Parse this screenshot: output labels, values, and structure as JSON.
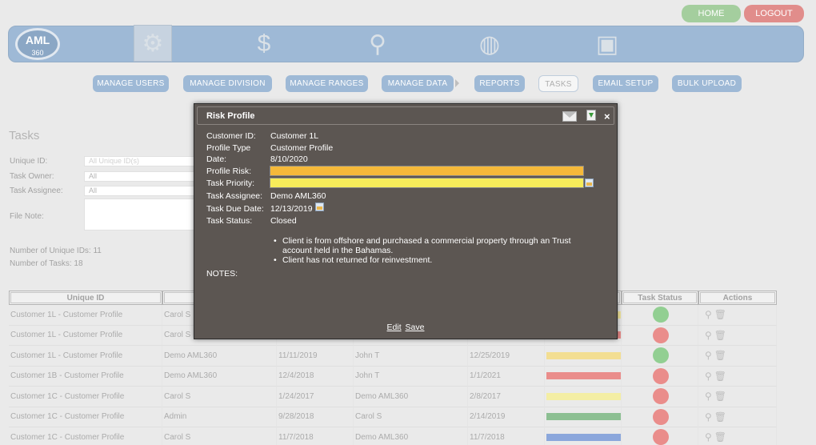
{
  "header": {
    "home_label": "HOME",
    "logout_label": "LOGOUT",
    "logo_text": "AML",
    "logo_sub": "360"
  },
  "nav_icons": [
    "gears-icon",
    "money-icon",
    "location-user-icon",
    "globe-icon",
    "briefcase-icon"
  ],
  "subnav": {
    "items": [
      "MANAGE USERS",
      "MANAGE DIVISION",
      "MANAGE RANGES",
      "MANAGE DATA",
      "REPORTS",
      "TASKS",
      "EMAIL SETUP",
      "BULK UPLOAD"
    ],
    "active": "TASKS"
  },
  "page": {
    "title": "Tasks",
    "unique_id_label": "Unique ID:",
    "unique_id_placeholder": "All Unique ID(s)",
    "task_owner_label": "Task Owner:",
    "task_owner_value": "All",
    "task_assignee_label": "Task Assignee:",
    "task_assignee_value": "All",
    "file_note_label": "File Note:",
    "unique_ids_count": "Number of Unique IDs: 11",
    "tasks_count": "Number of Tasks: 18"
  },
  "table": {
    "headers": [
      "Unique ID",
      "",
      "",
      "",
      "",
      "",
      "Task Status",
      "Actions"
    ],
    "rows": [
      {
        "uid": "Customer 1L - Customer Profile",
        "owner": "Carol S",
        "d1": "",
        "assignee": "",
        "d2": "",
        "risk": "#e9d24d",
        "status": "#3aa83a"
      },
      {
        "uid": "Customer 1L - Customer Profile",
        "owner": "Carol S",
        "d1": "",
        "assignee": "",
        "d2": "",
        "risk": "#d9302c",
        "status": "#d9302c"
      },
      {
        "uid": "Customer 1L - Customer Profile",
        "owner": "Demo AML360",
        "d1": "11/11/2019",
        "assignee": "John T",
        "d2": "12/25/2019",
        "risk": "#e9c43a",
        "status": "#3aa83a"
      },
      {
        "uid": "Customer 1B - Customer Profile",
        "owner": "Demo AML360",
        "d1": "12/4/2018",
        "assignee": "John T",
        "d2": "1/1/2021",
        "risk": "#d9302c",
        "status": "#d9302c"
      },
      {
        "uid": "Customer 1C - Customer Profile",
        "owner": "Carol S",
        "d1": "1/24/2017",
        "assignee": "Demo AML360",
        "d2": "2/8/2017",
        "risk": "#ece15a",
        "status": "#d9302c"
      },
      {
        "uid": "Customer 1C - Customer Profile",
        "owner": "Admin",
        "d1": "9/28/2018",
        "assignee": "Carol S",
        "d2": "2/14/2019",
        "risk": "#2e8b3a",
        "status": "#d9302c"
      },
      {
        "uid": "Customer 1C - Customer Profile",
        "owner": "Carol S",
        "d1": "11/7/2018",
        "assignee": "Demo AML360",
        "d2": "11/7/2018",
        "risk": "#2c5fbf",
        "status": "#d9302c"
      }
    ]
  },
  "modal": {
    "title": "Risk Profile",
    "customer_id_label": "Customer ID:",
    "customer_id": "Customer 1L",
    "profile_type_label": "Profile Type",
    "profile_type": "Customer Profile",
    "date_label": "Date:",
    "date": "8/10/2020",
    "profile_risk_label": "Profile Risk:",
    "profile_risk_color": "#f5b93a",
    "task_priority_label": "Task Priority:",
    "task_priority_color": "#f7ec5a",
    "task_assignee_label": "Task Assignee:",
    "task_assignee": "Demo AML360",
    "task_due_date_label": "Task Due Date:",
    "task_due_date": "12/13/2019",
    "task_status_label": "Task Status:",
    "task_status": "Closed",
    "notes": [
      "Client is from offshore and purchased a commercial property through an Trust account held in the Bahamas.",
      "Client has not returned for reinvestment."
    ],
    "notes_label": "NOTES:",
    "edit_label": "Edit",
    "save_label": "Save"
  }
}
